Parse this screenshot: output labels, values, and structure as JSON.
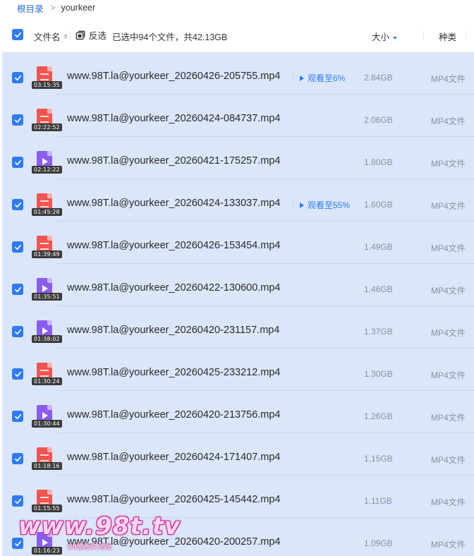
{
  "breadcrumb": {
    "root": "根目录",
    "separator": ">",
    "current": "yourkeer"
  },
  "header": {
    "name_label": "文件名",
    "invert_label": "反选",
    "selected_summary": "已选中94个文件，共42.13GB",
    "size_label": "大小",
    "type_label": "种类"
  },
  "colors": {
    "accent": "#2f7bf5",
    "selected_row_bg": "#dbe6fb",
    "video_red": "#f2554f",
    "video_purple": "#8a5cf0"
  },
  "files": [
    {
      "name": "www.98T.la@yourkeer_20260426-205755.mp4",
      "duration": "03:15:35",
      "size": "2.84GB",
      "type": "MP4文件",
      "icon": "video-red-icon",
      "watch": "观看至6%"
    },
    {
      "name": "www.98T.la@yourkeer_20260424-084737.mp4",
      "duration": "02:22:52",
      "size": "2.06GB",
      "type": "MP4文件",
      "icon": "video-red-icon",
      "watch": ""
    },
    {
      "name": "www.98T.la@yourkeer_20260421-175257.mp4",
      "duration": "02:12:22",
      "size": "1.80GB",
      "type": "MP4文件",
      "icon": "video-purple-icon",
      "watch": ""
    },
    {
      "name": "www.98T.la@yourkeer_20260424-133037.mp4",
      "duration": "01:45:28",
      "size": "1.60GB",
      "type": "MP4文件",
      "icon": "video-red-icon",
      "watch": "观看至55%"
    },
    {
      "name": "www.98T.la@yourkeer_20260426-153454.mp4",
      "duration": "01:39:49",
      "size": "1.49GB",
      "type": "MP4文件",
      "icon": "video-red-icon",
      "watch": ""
    },
    {
      "name": "www.98T.la@yourkeer_20260422-130600.mp4",
      "duration": "01:35:51",
      "size": "1.46GB",
      "type": "MP4文件",
      "icon": "video-purple-icon",
      "watch": ""
    },
    {
      "name": "www.98T.la@yourkeer_20260420-231157.mp4",
      "duration": "01:38:02",
      "size": "1.37GB",
      "type": "MP4文件",
      "icon": "video-purple-icon",
      "watch": ""
    },
    {
      "name": "www.98T.la@yourkeer_20260425-233212.mp4",
      "duration": "01:30:24",
      "size": "1.30GB",
      "type": "MP4文件",
      "icon": "video-red-icon",
      "watch": ""
    },
    {
      "name": "www.98T.la@yourkeer_20260420-213756.mp4",
      "duration": "01:30:44",
      "size": "1.26GB",
      "type": "MP4文件",
      "icon": "video-purple-icon",
      "watch": ""
    },
    {
      "name": "www.98T.la@yourkeer_20260424-171407.mp4",
      "duration": "01:18:16",
      "size": "1.15GB",
      "type": "MP4文件",
      "icon": "video-red-icon",
      "watch": ""
    },
    {
      "name": "www.98T.la@yourkeer_20260425-145442.mp4",
      "duration": "01:15:55",
      "size": "1.11GB",
      "type": "MP4文件",
      "icon": "video-red-icon",
      "watch": ""
    },
    {
      "name": "www.98T.la@yourkeer_20260420-200257.mp4",
      "duration": "01:16:23",
      "size": "1.09GB",
      "type": "MP4文件",
      "icon": "video-purple-icon",
      "watch": ""
    }
  ],
  "watermark": {
    "text": "www.98t.tv",
    "subtext": "98堂永久地址"
  }
}
